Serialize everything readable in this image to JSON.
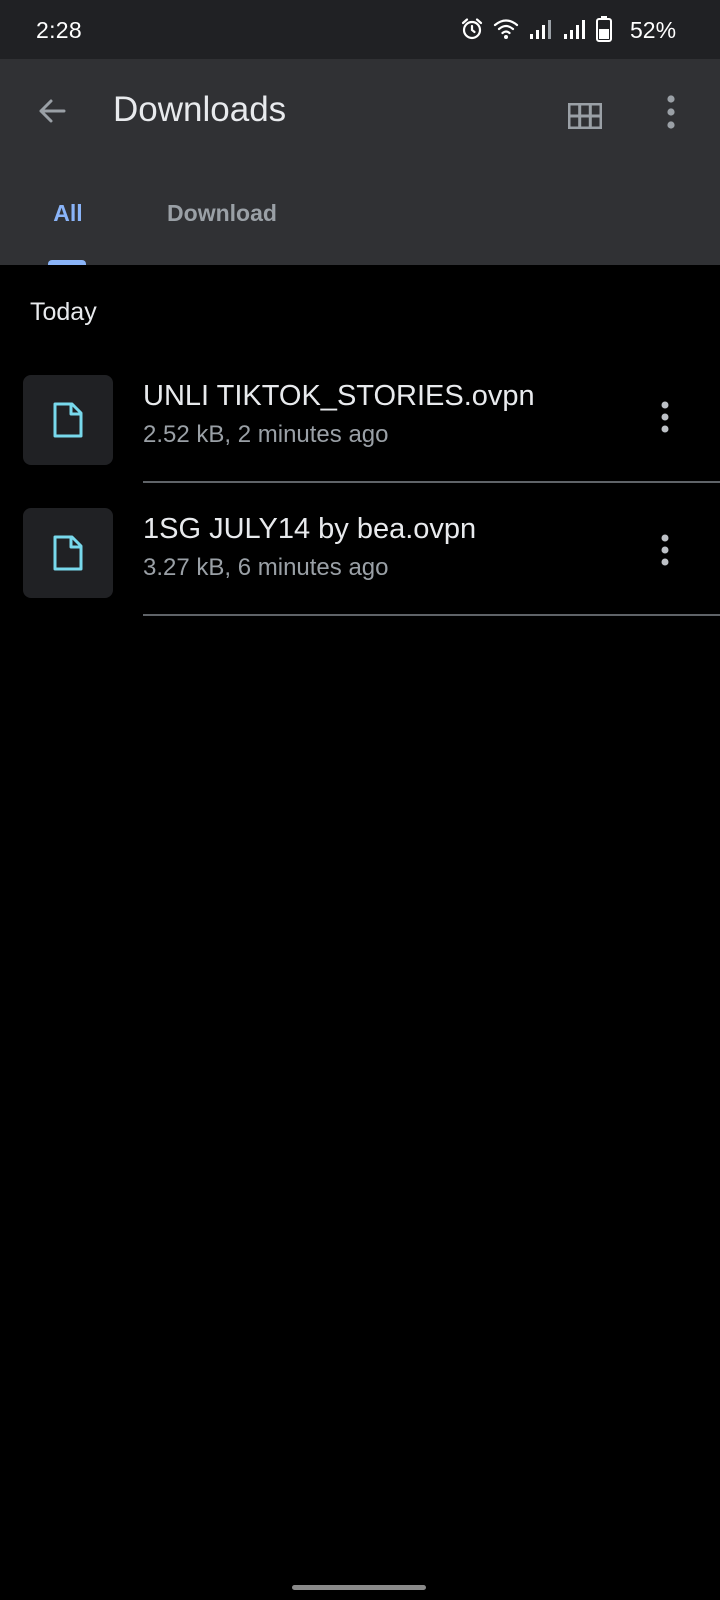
{
  "status_bar": {
    "time": "2:28",
    "battery_percent": "52%",
    "icons": [
      "alarm-icon",
      "wifi-icon",
      "signal-icon",
      "signal-icon",
      "battery-icon"
    ]
  },
  "app_bar": {
    "title": "Downloads",
    "icons": [
      "back-arrow-icon",
      "grid-view-icon",
      "more-vertical-icon"
    ]
  },
  "tabs": [
    {
      "label": "All",
      "selected": true
    },
    {
      "label": "Download",
      "selected": false
    }
  ],
  "colors": {
    "accent": "#8ab4f8",
    "file_icon": "#78d9ec",
    "app_bar_bg": "#303134",
    "status_bar_bg": "#202124",
    "background": "#000000"
  },
  "files": {
    "section_header": "Today",
    "items": [
      {
        "name": "UNLI TIKTOK_STORIES.ovpn",
        "meta": "2.52 kB, 2 minutes ago",
        "icon": "file-icon"
      },
      {
        "name": "1SG JULY14 by bea.ovpn",
        "meta": "3.27 kB, 6 minutes ago",
        "icon": "file-icon"
      }
    ]
  }
}
